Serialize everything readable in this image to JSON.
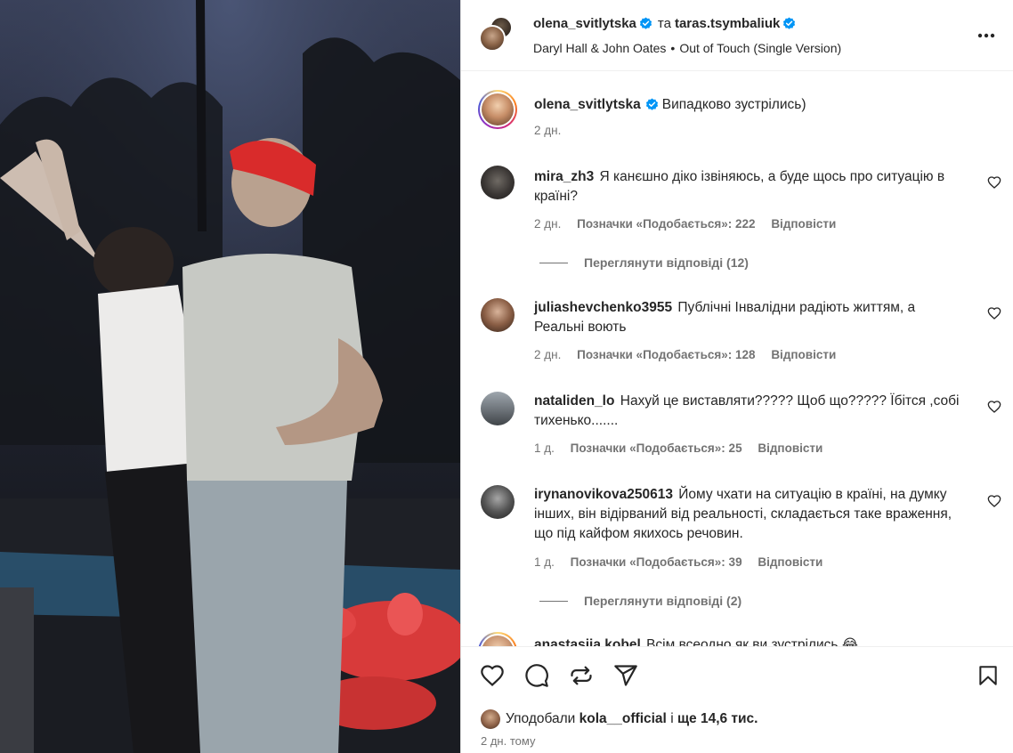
{
  "header": {
    "author1": "olena_svitlytska",
    "conjunction": "та",
    "author2": "taras.tsymbaliuk",
    "artist": "Daryl Hall & John Oates",
    "separator": "•",
    "track": "Out of Touch (Single Version)"
  },
  "caption": {
    "username": "olena_svitlytska",
    "text": "Випадково зустрілись)",
    "time": "2 дн."
  },
  "comments": [
    {
      "username": "mira_zh3",
      "text": "Я канєшно діко ізвіняюсь, а буде щось про ситуацію в країні?",
      "time": "2 дн.",
      "likes": "Позначки «Подобається»: 222",
      "reply": "Відповісти",
      "view_replies": "Переглянути відповіді (12)"
    },
    {
      "username": "juliashevchenko3955",
      "text": "Публічні Інвалідни радіють життям, а Реальні воють",
      "time": "2 дн.",
      "likes": "Позначки «Подобається»: 128",
      "reply": "Відповісти"
    },
    {
      "username": "nataliden_lo",
      "text": "Нахуй це виставляти????? Щоб що????? Їбітся ,собі тихенько.......",
      "time": "1 д.",
      "likes": "Позначки «Подобається»: 25",
      "reply": "Відповісти"
    },
    {
      "username": "irynanovikova250613",
      "text": "Йому чхати на ситуацію в країні, на думку інших, він відірваний від реальності, складається таке враження, що під кайфом якихось речовин.",
      "time": "1 д.",
      "likes": "Позначки «Подобається»: 39",
      "reply": "Відповісти",
      "view_replies": "Переглянути відповіді (2)"
    },
    {
      "username": "anastasiia.kobel",
      "text": "Всім всеодно як ви зустрілись 😂"
    }
  ],
  "likes_line": {
    "prefix": "Уподобали",
    "user": "kola__official",
    "middle": "і",
    "count": "ще 14,6 тис."
  },
  "post_time": "2 дн. тому",
  "icons": {
    "like": "heart-icon",
    "comment": "comment-icon",
    "repost": "repost-icon",
    "share": "send-icon",
    "save": "bookmark-icon",
    "more": "more-icon",
    "verified": "verified-badge-icon"
  },
  "colors": {
    "verified": "#0095f6",
    "text": "#262626",
    "secondary": "#737373"
  }
}
